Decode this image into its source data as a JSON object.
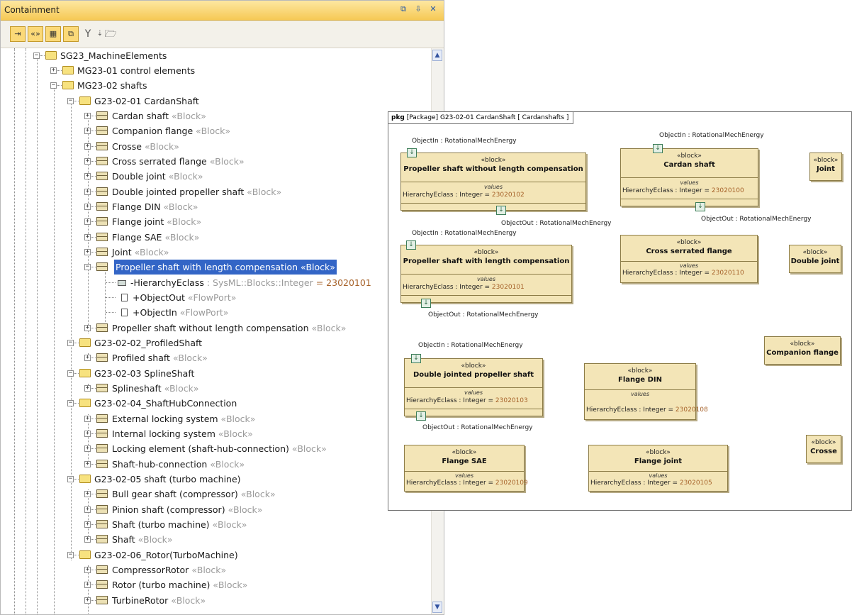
{
  "browser": {
    "title": "Containment",
    "title_buttons": [
      "⧉",
      "⇩",
      "✕"
    ],
    "toolbar": [
      "⇥",
      "«»",
      "▦",
      "⧉",
      "Y",
      "⇣",
      "🗁"
    ]
  },
  "tree": [
    {
      "label": "SG23_MachineElements",
      "type": "folder",
      "expanded": true
    },
    {
      "label": "MG23-01 control elements",
      "type": "folder",
      "expanded": false
    },
    {
      "label": "MG23-02 shafts",
      "type": "folder",
      "expanded": true
    },
    {
      "label": "G23-02-01 CardanShaft",
      "type": "folder",
      "expanded": true
    },
    {
      "label": "Cardan shaft",
      "stereo": "«Block»",
      "type": "block"
    },
    {
      "label": "Companion flange",
      "stereo": "«Block»",
      "type": "block"
    },
    {
      "label": "Crosse",
      "stereo": "«Block»",
      "type": "block"
    },
    {
      "label": "Cross serrated flange",
      "stereo": "«Block»",
      "type": "block"
    },
    {
      "label": "Double joint",
      "stereo": "«Block»",
      "type": "block"
    },
    {
      "label": "Double jointed propeller shaft",
      "stereo": "«Block»",
      "type": "block"
    },
    {
      "label": "Flange DIN",
      "stereo": "«Block»",
      "type": "block"
    },
    {
      "label": "Flange joint",
      "stereo": "«Block»",
      "type": "block"
    },
    {
      "label": "Flange SAE",
      "stereo": "«Block»",
      "type": "block"
    },
    {
      "label": "Joint",
      "stereo": "«Block»",
      "type": "block"
    },
    {
      "label": "Propeller shaft with length compensation",
      "stereo": "«Block»",
      "type": "block",
      "selected": true,
      "expanded": true
    },
    {
      "label": "-HierarchyEclass",
      "typeref": " : SysML::Blocks::Integer",
      "value": " = 23020101",
      "type": "prop"
    },
    {
      "label": "+ObjectOut",
      "stereo": "«FlowPort»",
      "type": "port"
    },
    {
      "label": "+ObjectIn",
      "stereo": "«FlowPort»",
      "type": "port"
    },
    {
      "label": "Propeller shaft without length compensation",
      "stereo": "«Block»",
      "type": "block"
    },
    {
      "label": "G23-02-02_ProfiledShaft",
      "type": "folder",
      "expanded": true
    },
    {
      "label": "Profiled shaft",
      "stereo": "«Block»",
      "type": "block"
    },
    {
      "label": "G23-02-03 SplineShaft",
      "type": "folder",
      "expanded": true
    },
    {
      "label": "Splineshaft",
      "stereo": "«Block»",
      "type": "block"
    },
    {
      "label": "G23-02-04_ShaftHubConnection",
      "type": "folder",
      "expanded": true
    },
    {
      "label": "External locking system",
      "stereo": "«Block»",
      "type": "block"
    },
    {
      "label": "Internal locking system",
      "stereo": "«Block»",
      "type": "block"
    },
    {
      "label": "Locking element (shaft-hub-connection)",
      "stereo": "«Block»",
      "type": "block"
    },
    {
      "label": "Shaft-hub-connection",
      "stereo": "«Block»",
      "type": "block"
    },
    {
      "label": "G23-02-05 shaft (turbo machine)",
      "type": "folder",
      "expanded": true
    },
    {
      "label": "Bull gear shaft (compressor)",
      "stereo": "«Block»",
      "type": "block"
    },
    {
      "label": "Pinion shaft (compressor)",
      "stereo": "«Block»",
      "type": "block"
    },
    {
      "label": "Shaft (turbo machine)",
      "stereo": "«Block»",
      "type": "block"
    },
    {
      "label": "Shaft",
      "stereo": "«Block»",
      "type": "block"
    },
    {
      "label": "G23-02-06_Rotor(TurboMachine)",
      "type": "folder",
      "expanded": true
    },
    {
      "label": "CompressorRotor",
      "stereo": "«Block»",
      "type": "block"
    },
    {
      "label": "Rotor (turbo machine)",
      "stereo": "«Block»",
      "type": "block"
    },
    {
      "label": "TurbineRotor",
      "stereo": "«Block»",
      "type": "block"
    }
  ],
  "diagram": {
    "frame_kind": "pkg",
    "frame_label": "[Package] G23-02-01 CardanShaft [ Cardanshafts ]",
    "blocks": [
      {
        "id": "propeller-without",
        "stereo": "«block»",
        "name": "Propeller shaft without length compensation",
        "values_header": "values",
        "values": "HierarchyEclass : Integer = ",
        "num": "23020102"
      },
      {
        "id": "cardan",
        "stereo": "«block»",
        "name": "Cardan shaft",
        "values_header": "values",
        "values": "HierarchyEclass : Integer = ",
        "num": "23020100"
      },
      {
        "id": "joint",
        "stereo": "«block»",
        "name": "Joint"
      },
      {
        "id": "propeller-with",
        "stereo": "«block»",
        "name": "Propeller shaft with length compensation",
        "values_header": "values",
        "values": "HierarchyEclass : Integer = ",
        "num": "23020101"
      },
      {
        "id": "cross-serrated",
        "stereo": "«block»",
        "name": "Cross serrated flange",
        "values_header": "values",
        "values": "HierarchyEclass : Integer = ",
        "num": "23020110"
      },
      {
        "id": "double-joint",
        "stereo": "«block»",
        "name": "Double joint"
      },
      {
        "id": "companion",
        "stereo": "«block»",
        "name": "Companion flange"
      },
      {
        "id": "double-jointed",
        "stereo": "«block»",
        "name": "Double jointed propeller shaft",
        "values_header": "values",
        "values": "HierarchyEclass : Integer = ",
        "num": "23020103"
      },
      {
        "id": "flange-din",
        "stereo": "«block»",
        "name": "Flange DIN",
        "values_header": "values",
        "values": "HierarchyEclass : Integer = ",
        "num": "23020108"
      },
      {
        "id": "flange-sae",
        "stereo": "«block»",
        "name": "Flange SAE",
        "values_header": "values",
        "values": "HierarchyEclass : Integer = ",
        "num": "23020109"
      },
      {
        "id": "flange-joint",
        "stereo": "«block»",
        "name": "Flange joint",
        "values_header": "values",
        "values": "HierarchyEclass : Integer = ",
        "num": "23020105"
      },
      {
        "id": "crosse",
        "stereo": "«block»",
        "name": "Crosse"
      }
    ],
    "port_labels": {
      "in": "ObjectIn : RotationalMechEnergy",
      "out": "ObjectOut : RotationalMechEnergy"
    }
  }
}
